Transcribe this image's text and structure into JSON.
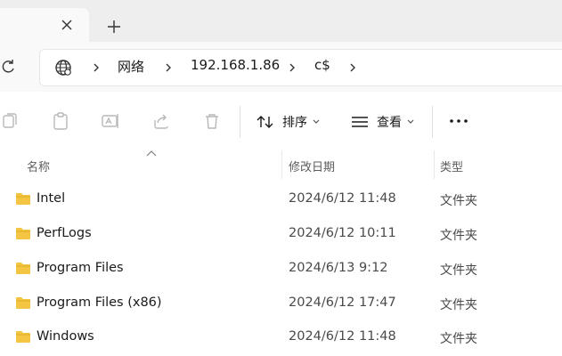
{
  "tab": {
    "close_icon": "close-icon",
    "new_tab_icon": "plus-icon"
  },
  "address": {
    "breadcrumbs": [
      "网络",
      "192.168.1.86",
      "c$"
    ]
  },
  "toolbar": {
    "sort_label": "排序",
    "view_label": "查看"
  },
  "columns": {
    "name": "名称",
    "date": "修改日期",
    "type": "类型"
  },
  "files": [
    {
      "name": "Intel",
      "date": "2024/6/12 11:48",
      "type": "文件夹"
    },
    {
      "name": "PerfLogs",
      "date": "2024/6/12 10:11",
      "type": "文件夹"
    },
    {
      "name": "Program Files",
      "date": "2024/6/13 9:12",
      "type": "文件夹"
    },
    {
      "name": "Program Files (x86)",
      "date": "2024/6/12 17:47",
      "type": "文件夹"
    },
    {
      "name": "Windows",
      "date": "2024/6/12 11:48",
      "type": "文件夹"
    }
  ],
  "colors": {
    "folder": "#f4c542",
    "disabled_icon": "#b8b8b8",
    "accent": "#1a1a1a"
  }
}
